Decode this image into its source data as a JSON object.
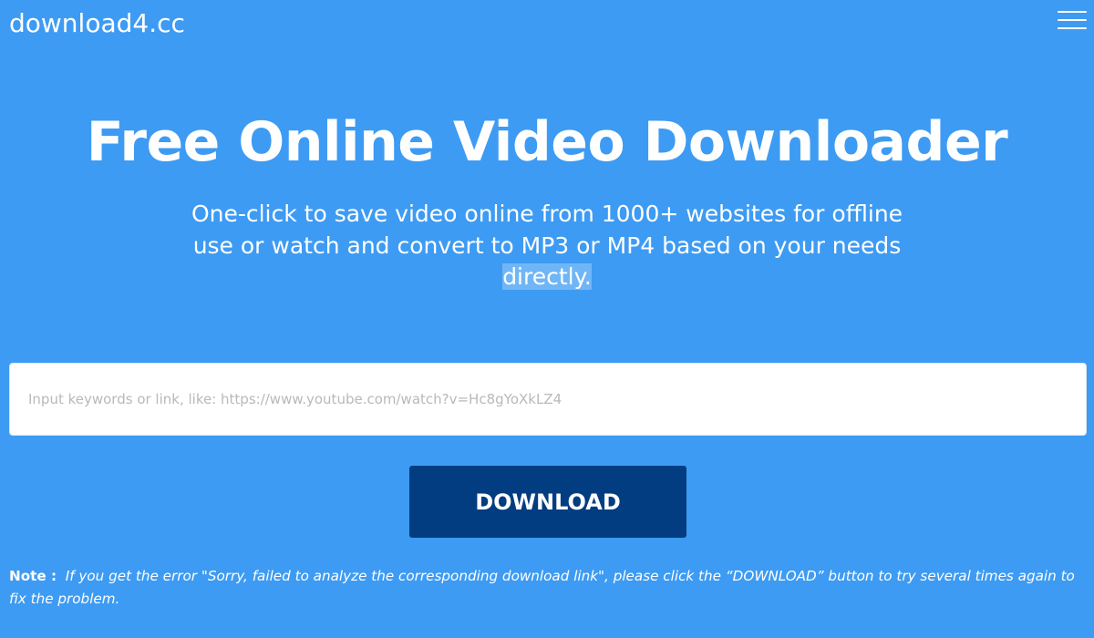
{
  "header": {
    "brand": "download4.cc",
    "menu_icon": "hamburger-menu-icon"
  },
  "hero": {
    "title": "Free Online Video Downloader",
    "subtitle_main": "One-click to save video online from 1000+ websites for offline use or watch and convert to MP3 or MP4 based on your needs",
    "subtitle_highlight": " directly."
  },
  "search": {
    "value": "",
    "placeholder": "Input keywords or link, like: https://www.youtube.com/watch?v=Hc8gYoXkLZ4"
  },
  "actions": {
    "download_label": "DOWNLOAD"
  },
  "note": {
    "label": "Note :",
    "text": "If you get the error \"Sorry, failed to analyze the corresponding download link\", please click the “DOWNLOAD” button to try several times again to fix the problem."
  },
  "colors": {
    "background": "#3d9bf3",
    "download_button": "#013d80",
    "text": "#ffffff",
    "selection_highlight": "#70b6f6"
  }
}
